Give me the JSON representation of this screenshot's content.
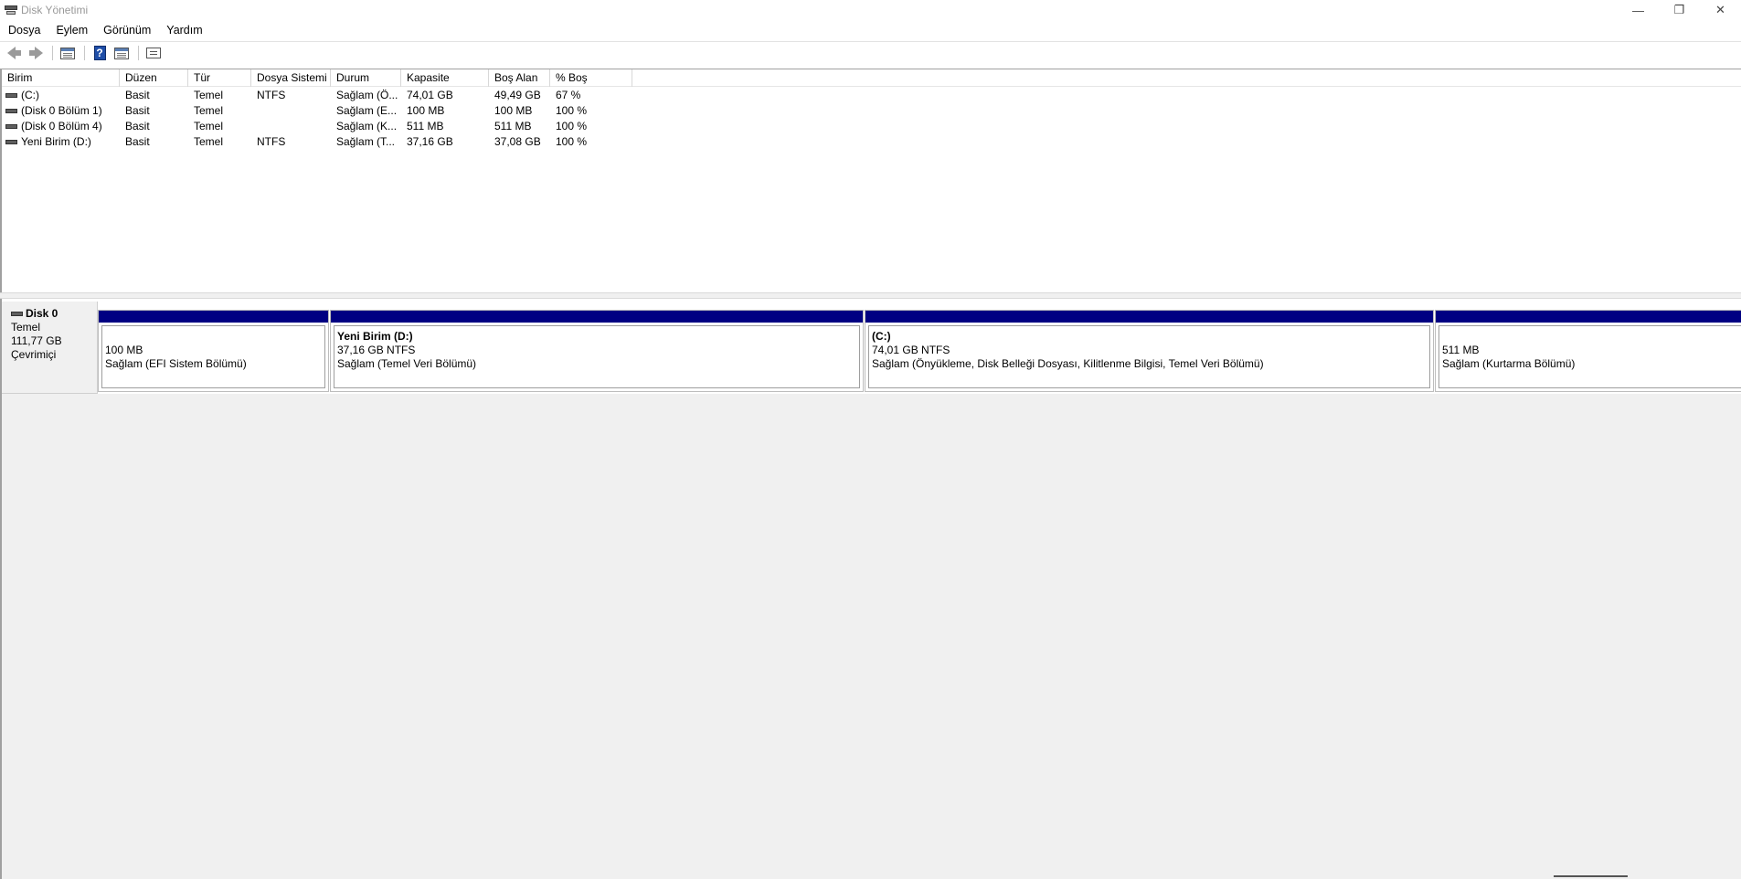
{
  "window": {
    "title": "Disk Yönetimi",
    "controls": {
      "minimize": "—",
      "restore": "❐",
      "close": "✕"
    }
  },
  "menu": [
    "Dosya",
    "Eylem",
    "Görünüm",
    "Yardım"
  ],
  "toolbar": {
    "icons": [
      "back-arrow-icon",
      "forward-arrow-icon",
      "console-tree-icon",
      "help-icon",
      "properties-icon",
      "list-view-icon"
    ],
    "help_glyph": "?"
  },
  "table": {
    "columns": [
      "Birim",
      "Düzen",
      "Tür",
      "Dosya Sistemi",
      "Durum",
      "Kapasite",
      "Boş Alan",
      "% Boş"
    ],
    "rows": [
      {
        "birim": " (C:)",
        "duzen": "Basit",
        "tur": "Temel",
        "dosya": "NTFS",
        "durum": "Sağlam (Ö...",
        "kapasite": "74,01 GB",
        "bos": "49,49 GB",
        "pct": "67 %"
      },
      {
        "birim": " (Disk 0 Bölüm 1)",
        "duzen": "Basit",
        "tur": "Temel",
        "dosya": "",
        "durum": "Sağlam (E...",
        "kapasite": "100 MB",
        "bos": "100 MB",
        "pct": "100 %"
      },
      {
        "birim": " (Disk 0 Bölüm 4)",
        "duzen": "Basit",
        "tur": "Temel",
        "dosya": "",
        "durum": "Sağlam (K...",
        "kapasite": "511 MB",
        "bos": "511 MB",
        "pct": "100 %"
      },
      {
        "birim": "Yeni Birim (D:)",
        "duzen": "Basit",
        "tur": "Temel",
        "dosya": "NTFS",
        "durum": "Sağlam (T...",
        "kapasite": "37,16 GB",
        "bos": "37,08 GB",
        "pct": "100 %"
      }
    ]
  },
  "disk": {
    "name": "Disk 0",
    "type": "Temel",
    "size": "111,77 GB",
    "status": "Çevrimiçi",
    "partitions": [
      {
        "name": "",
        "size": "100 MB",
        "status": "Sağlam (EFI Sistem Bölümü)"
      },
      {
        "name": "Yeni Birim  (D:)",
        "size": "37,16 GB NTFS",
        "status": "Sağlam (Temel Veri Bölümü)"
      },
      {
        "name": " (C:)",
        "size": "74,01 GB NTFS",
        "status": "Sağlam (Önyükleme, Disk Belleği Dosyası, Kilitlenme Bilgisi, Temel Veri Bölümü)"
      },
      {
        "name": "",
        "size": "511 MB",
        "status": "Sağlam (Kurtarma Bölümü)"
      }
    ]
  },
  "colors": {
    "partition_bar": "#000082",
    "background": "#f0f0f0"
  }
}
